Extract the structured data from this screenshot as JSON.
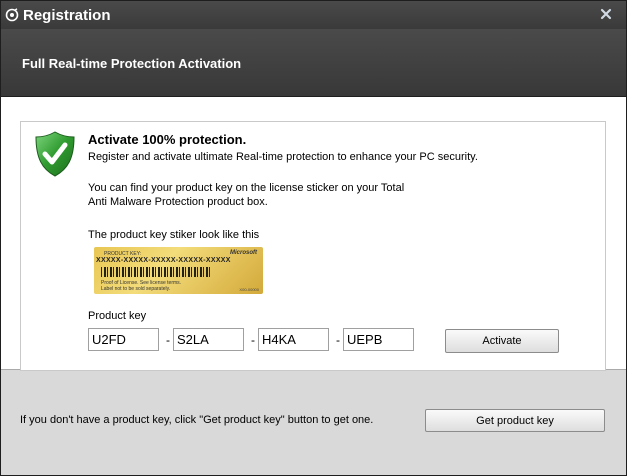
{
  "window": {
    "title": "Registration",
    "header_title": "Full Real-time Protection Activation"
  },
  "panel": {
    "heading": "Activate 100% protection.",
    "line1": "Register and activate ultimate Real-time protection to enhance your PC security.",
    "line2": "You can find your product key on the license sticker on your Total",
    "line3": "Anti Malware Protection product box.",
    "sticker_caption": "The product key stiker look like this",
    "product_key_label": "Product key"
  },
  "sticker": {
    "label": "PRODUCT KEY:",
    "brand": "Microsoft",
    "key": "XXXXX-XXXXX-XXXXX-XXXXX-XXXXX",
    "fine1": "Proof of License. See license terms.",
    "fine2": "Label not to be sold separately.",
    "code": "X00-00000"
  },
  "product_key": {
    "part1": "U2FD",
    "part2": "S2LA",
    "part3": "H4KA",
    "part4": "UEPB",
    "separator": "-"
  },
  "buttons": {
    "activate": "Activate",
    "get_product_key": "Get product key"
  },
  "footer": {
    "text": "If you don't have a product key, click \"Get product key\" button to get one."
  },
  "icons": {
    "app": "registration-app-icon",
    "close": "close-icon",
    "shield": "shield-check-icon"
  },
  "colors": {
    "titlebar": "#3a3a3a",
    "shield_green": "#2f9b2f",
    "sticker_gold": "#e8c653"
  }
}
